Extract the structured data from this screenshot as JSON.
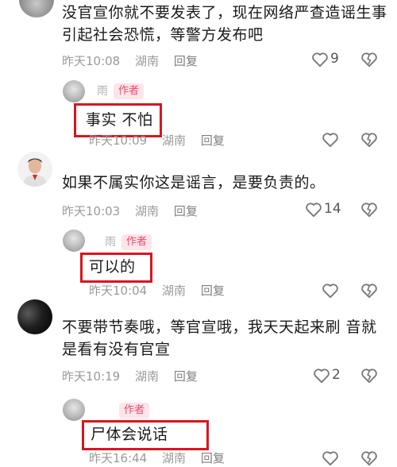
{
  "comments": [
    {
      "text_line1": "没官宣你就不要发表了，现在网络严查造谣生事",
      "text_line2": "引起社会恐慌，等警方发布吧",
      "time": "昨天10:08",
      "location": "湖南",
      "reply_label": "回复",
      "likes": "9"
    },
    {
      "name_fragment": "雨",
      "badge": "作者",
      "text": "事实 不怕",
      "time": "昨天10:09",
      "location": "湖南",
      "reply_label": "回复"
    },
    {
      "text": "如果不属实你这是谣言，是要负责的。",
      "time": "昨天10:03",
      "location": "湖南",
      "reply_label": "回复",
      "likes": "14"
    },
    {
      "name_fragment": "雨",
      "badge": "作者",
      "text": "可以的",
      "time": "昨天10:04",
      "location": "湖南",
      "reply_label": "回复"
    },
    {
      "text_line1": "不要带节奏哦，等官宣哦，我天天起来刷  音就",
      "text_line2": "是看有没有官宣",
      "time": "昨天10:19",
      "location": "湖南",
      "reply_label": "回复",
      "likes": "2"
    },
    {
      "badge": "作者",
      "text": "尸体会说话",
      "time": "昨天16:44",
      "location": "湖南",
      "reply_label": "回复"
    }
  ],
  "colors": {
    "highlight_box": "#d9151f",
    "author_badge": "#f0476b"
  },
  "icons": {
    "like": "heart-outline-icon",
    "dislike": "broken-heart-icon"
  }
}
